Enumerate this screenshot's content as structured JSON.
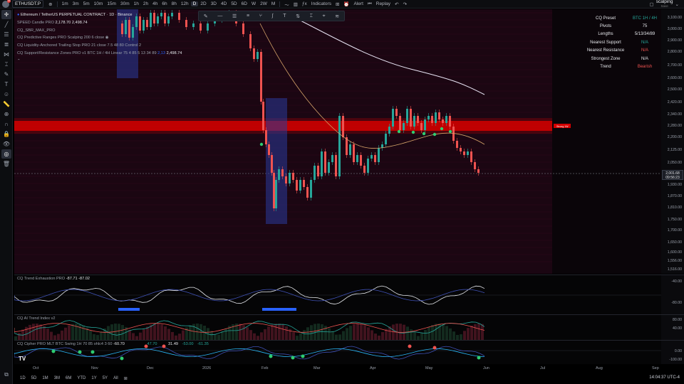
{
  "topbar": {
    "avatar_badge": "18",
    "symbol": "ETHUSDT.P",
    "intervals": [
      "1m",
      "3m",
      "5m",
      "10m",
      "15m",
      "30m",
      "1h",
      "2h",
      "4h",
      "6h",
      "8h",
      "12h",
      "D",
      "2D",
      "3D",
      "4D",
      "5D",
      "6D",
      "W",
      "2W",
      "M"
    ],
    "active_interval": "D",
    "indicators_label": "Indicators",
    "alert_label": "Alert",
    "replay_label": "Replay",
    "layout_name": "scalping",
    "layout_sub": "Save"
  },
  "legend": {
    "title": "Ethereum / TetherUS PERPETUAL CONTRACT · 1D · Binance",
    "line1_label": "SPEED Candle PRO",
    "line1_v1": "2,178.70",
    "line1_v2": "2,498.74",
    "line2_label": "CQ_SBR_MAX_PRO",
    "line3_label": "CQ Predictive Ranges PRO Scalping 200 6 close",
    "line4_label": "CQ Liquidity-Anchored Trailing Stop PRO 21 close 7.5 48 80 Control 2",
    "line5_label": "CQ Support/Resistance Zones PRO v1 BTC 1H / 4H Linear 75 4 85 5 13 34 89",
    "line5_v1": "2,13",
    "line5_v2": "2,498.74"
  },
  "info_table": [
    {
      "k": "CQ Preset",
      "v": "BTC 1H / 4H",
      "color": "#26a69a"
    },
    {
      "k": "Pivots",
      "v": "75",
      "color": "#e5e7eb"
    },
    {
      "k": "Lengths",
      "v": "5/13/34/89",
      "color": "#e5e7eb"
    },
    {
      "k": "Nearest Support",
      "v": "N/A",
      "color": "#26a69a"
    },
    {
      "k": "Nearest Resistance",
      "v": "N/A",
      "color": "#ef5350"
    },
    {
      "k": "Strongest Zone",
      "v": "N/A",
      "color": "#e5e7eb"
    },
    {
      "k": "Trend",
      "v": "Bearish",
      "color": "#ef5350"
    }
  ],
  "price_axis": {
    "ticks": [
      "3,100.00",
      "3,000.00",
      "2,900.00",
      "2,800.00",
      "2,700.00",
      "2,600.00",
      "2,500.00",
      "2,420.00",
      "2,340.00",
      "2,280.00",
      "2,200.00",
      "2,125.00",
      "2,050.00",
      "1,930.00",
      "1,870.00",
      "1,810.00",
      "1,750.00",
      "1,700.00",
      "1,650.00",
      "1,600.00",
      "1,556.00",
      "1,516.00"
    ],
    "last_price": "2,001.68",
    "countdown": "09:56:23"
  },
  "zone_label": "Strong 1W",
  "panes": [
    {
      "label": "CQ Trend Exhaustion PRO",
      "values": "-87.71  -87.02",
      "ticks": [
        "-40.00",
        "-80.00"
      ]
    },
    {
      "label": "CQ AI Trend Index v2",
      "values": "",
      "ticks": [
        "80.00",
        "40.00"
      ]
    },
    {
      "label": "CQ Cipher PRO MLT BTC Swing 1H 70 85 ohlc4 3 60",
      "values": "-60.70",
      "ticks": [
        "0.00",
        "-100.00"
      ]
    }
  ],
  "pane3_values": [
    "47.70",
    "31.49",
    "-53.00",
    "-61.35"
  ],
  "time_axis": [
    "Oct",
    "Nov",
    "Dec",
    "2026",
    "Feb",
    "Mar",
    "Apr",
    "May",
    "Jun",
    "Jul",
    "Aug",
    "Sep"
  ],
  "ranges": [
    "1D",
    "5D",
    "1M",
    "3M",
    "6M",
    "YTD",
    "1Y",
    "5Y",
    "All"
  ],
  "clock": "14:04:37 UTC-4",
  "colors": {
    "up": "#26a69a",
    "down": "#ef5350",
    "zone": "#d50000",
    "ma200": "#e8e4f4",
    "ma50": "#d6a46a",
    "bg": "#0a0509"
  }
}
